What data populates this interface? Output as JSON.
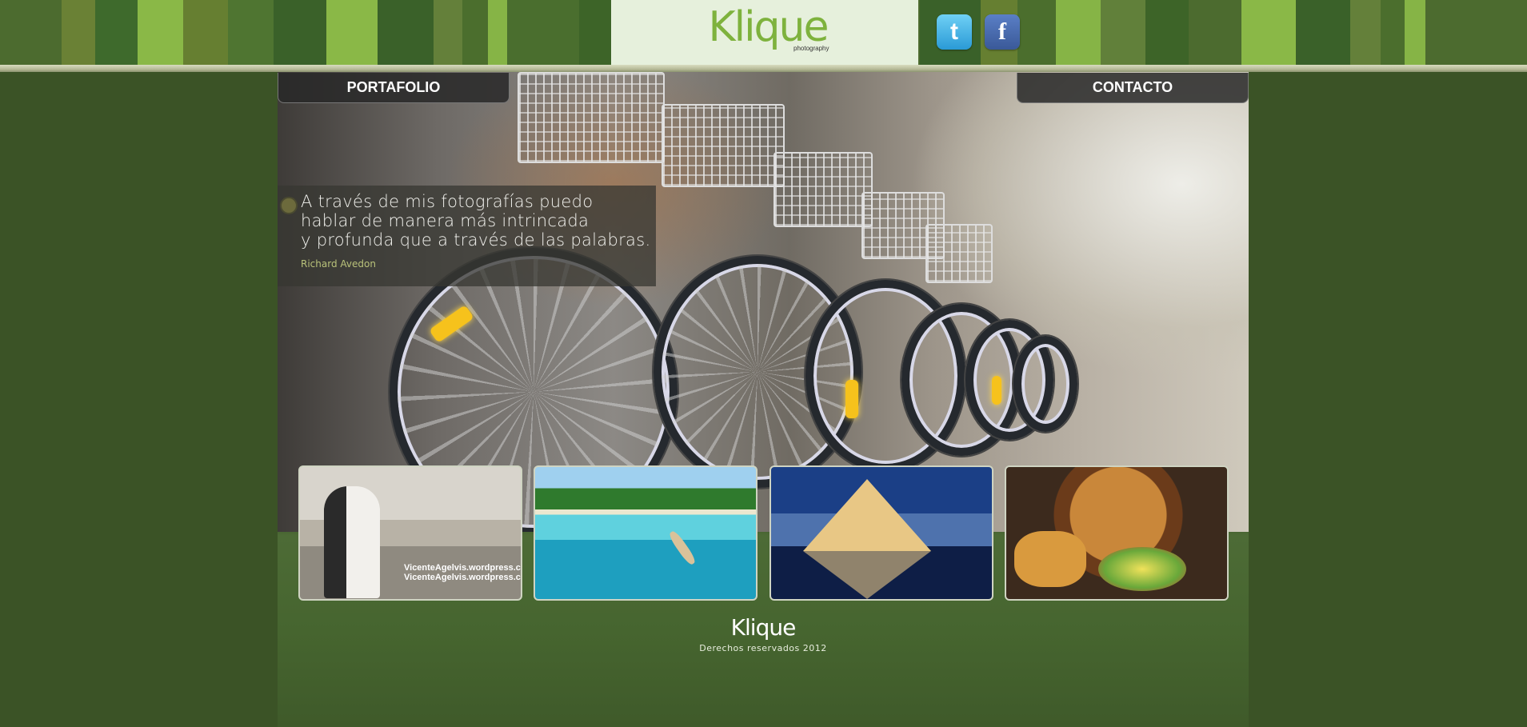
{
  "header": {
    "logo_text": "Klique",
    "logo_subtext": "photography",
    "social": {
      "twitter_glyph": "t",
      "facebook_glyph": "f"
    }
  },
  "nav": {
    "left_tab": "PORTAFOLIO",
    "right_tab": "CONTACTO"
  },
  "hero": {
    "quote": "A través de mis fotografías puedo\nhablar de manera más intrincada\ny profunda que a través de las palabras.",
    "author": "Richard Avedon"
  },
  "thumbnails": [
    {
      "name": "wedding-photo",
      "watermark": "VicenteAgelvis.wordpress.com\nVicenteAgelvis.wordpress.com"
    },
    {
      "name": "beach-photo"
    },
    {
      "name": "louvre-photo"
    },
    {
      "name": "food-photo"
    }
  ],
  "footer": {
    "logo_text": "Klique",
    "copyright": "Derechos reservados 2012"
  },
  "colors": {
    "page_bg": "#3b5326",
    "logo_green": "#7eb23d",
    "logo_box_bg": "#e6f0dc",
    "tab_bg": "#282828",
    "author_color": "#b9c27a"
  }
}
